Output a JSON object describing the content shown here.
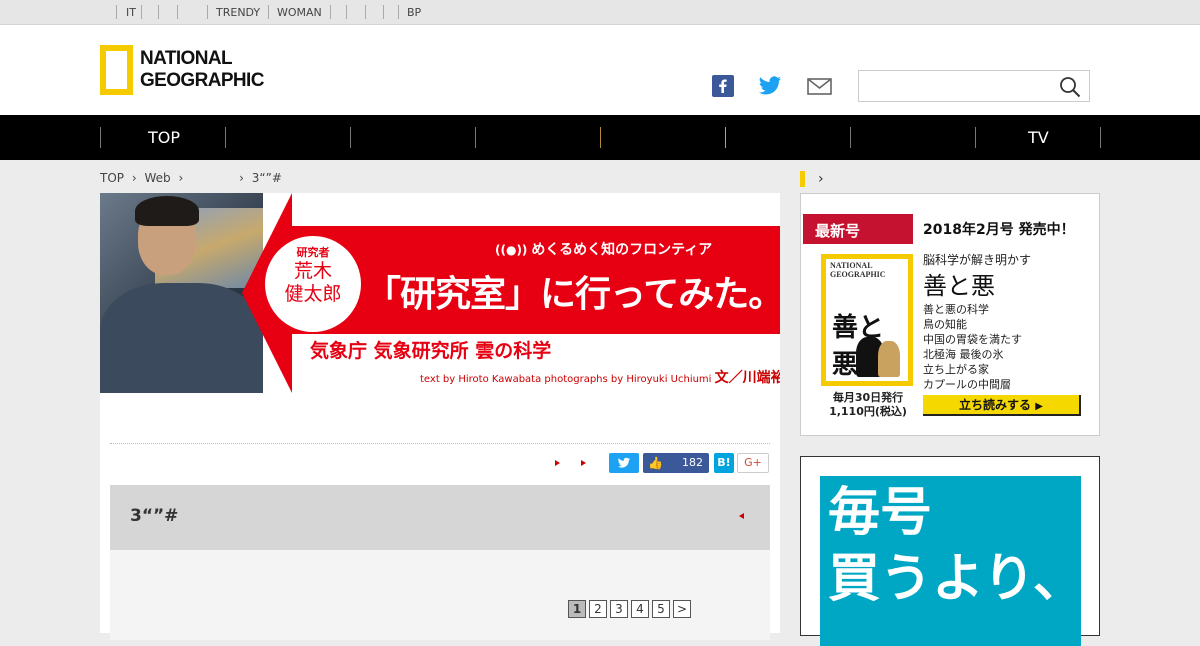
{
  "topbar": {
    "links": [
      "IT",
      "TRENDY",
      "WOMAN",
      "BP"
    ]
  },
  "header": {
    "logo_text": "NATIONAL\nGEOGRAPHIC",
    "social": [
      "facebook-icon",
      "twitter-icon",
      "mail-icon"
    ],
    "search": {
      "placeholder": ""
    }
  },
  "nav": {
    "items": [
      "TOP",
      "",
      "",
      "",
      "",
      "",
      "",
      "TV"
    ]
  },
  "breadcrumb": {
    "items": [
      "TOP",
      "Web",
      "",
      "3“”#"
    ]
  },
  "banner": {
    "researcher_role": "研究者",
    "researcher_name": "荒木\n健太郎",
    "series_tagline": "めくるめく知のフロンティア",
    "series_title": "「研究室」に行ってみた。",
    "subject": "気象庁 気象研究所 雲の科学",
    "credits_en": "text by Hiroto Kawabata photographs by Hiroyuki Uchiumi",
    "credits_jp": "文／川端裕人"
  },
  "share": {
    "like_count": "182",
    "hatena_label": "B!",
    "gplus_label": "G+"
  },
  "section": {
    "title": "3“”#"
  },
  "pagination": {
    "pages": [
      "1",
      "2",
      "3",
      "4",
      "5"
    ],
    "next": ">",
    "current": "1"
  },
  "sidebar": {
    "latest": {
      "label": "最新号",
      "release": "2018年2月号 発売中！",
      "lead": "脳科学が解き明かす",
      "headline": "善と悪",
      "topics": [
        "善と悪の科学",
        "鳥の知能",
        "中国の胃袋を満たす",
        "北極海 最後の氷",
        "立ち上がる家",
        "カプールの中間層"
      ],
      "pub_line1": "毎月30日発行",
      "pub_line2": "1,110円(税込)",
      "read_button": "立ち読みする",
      "cover_logo": "NATIONAL\nGEOGRAPHIC",
      "cover_title": "善と悪"
    },
    "ad": {
      "text": "毎号\n買うより、"
    }
  },
  "colors": {
    "brand_yellow": "#f5cb00",
    "banner_red": "#e60012",
    "nav_bg": "#000000",
    "ad_teal": "#00a7c4"
  }
}
